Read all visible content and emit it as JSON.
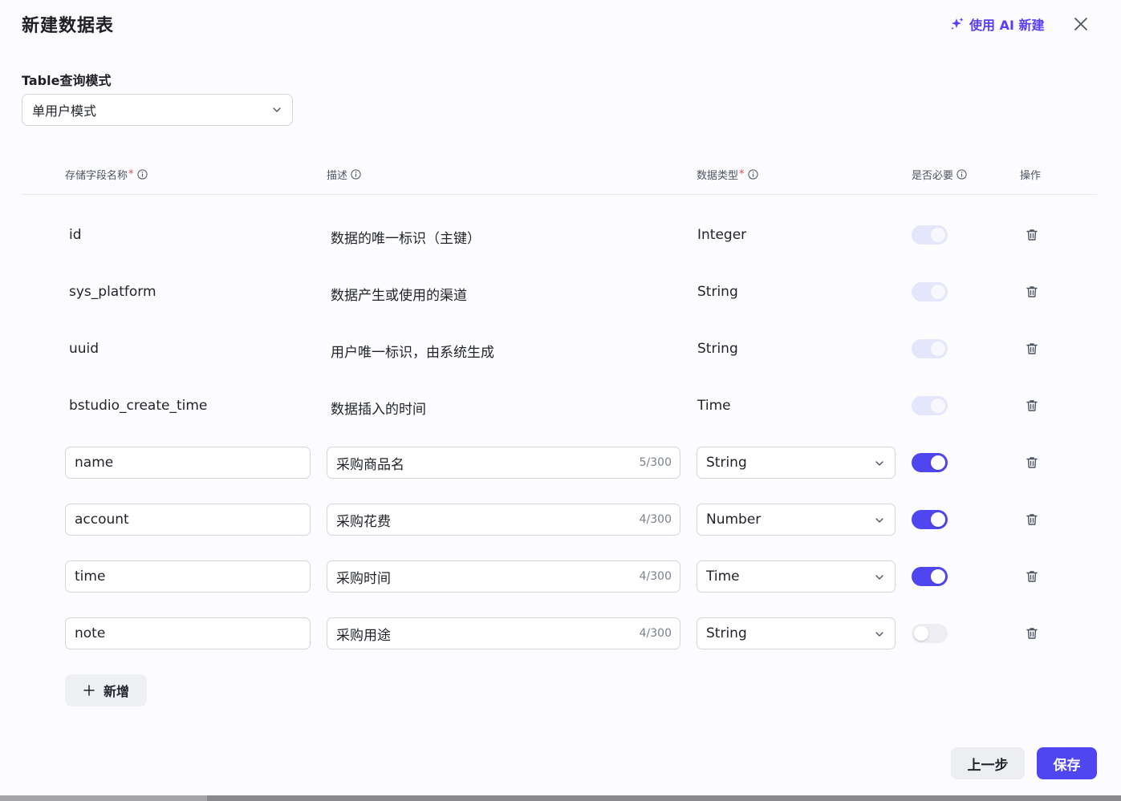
{
  "header": {
    "title": "新建数据表",
    "ai_button_label": "使用 AI 新建"
  },
  "mode": {
    "label": "Table查询模式",
    "selected": "单用户模式"
  },
  "columns": {
    "field_name": "存储字段名称",
    "description": "描述",
    "data_type": "数据类型",
    "required": "是否必要",
    "actions": "操作",
    "required_mark": "*"
  },
  "system_rows": [
    {
      "name": "id",
      "description": "数据的唯一标识（主键）",
      "type": "Integer",
      "required": true
    },
    {
      "name": "sys_platform",
      "description": "数据产生或使用的渠道",
      "type": "String",
      "required": true
    },
    {
      "name": "uuid",
      "description": "用户唯一标识，由系统生成",
      "type": "String",
      "required": true
    },
    {
      "name": "bstudio_create_time",
      "description": "数据插入的时间",
      "type": "Time",
      "required": true
    }
  ],
  "user_rows": [
    {
      "name": "name",
      "description": "采购商品名",
      "counter": "5/300",
      "type": "String",
      "required": true
    },
    {
      "name": "account",
      "description": "采购花费",
      "counter": "4/300",
      "type": "Number",
      "required": true
    },
    {
      "name": "time",
      "description": "采购时间",
      "counter": "4/300",
      "type": "Time",
      "required": true
    },
    {
      "name": "note",
      "description": "采购用途",
      "counter": "4/300",
      "type": "String",
      "required": false
    }
  ],
  "add_button_label": "新增",
  "footer": {
    "prev_label": "上一步",
    "save_label": "保存"
  },
  "colors": {
    "accent": "#5046f0",
    "ai_purple": "#5b3df5",
    "required_star": "#e5484d"
  }
}
